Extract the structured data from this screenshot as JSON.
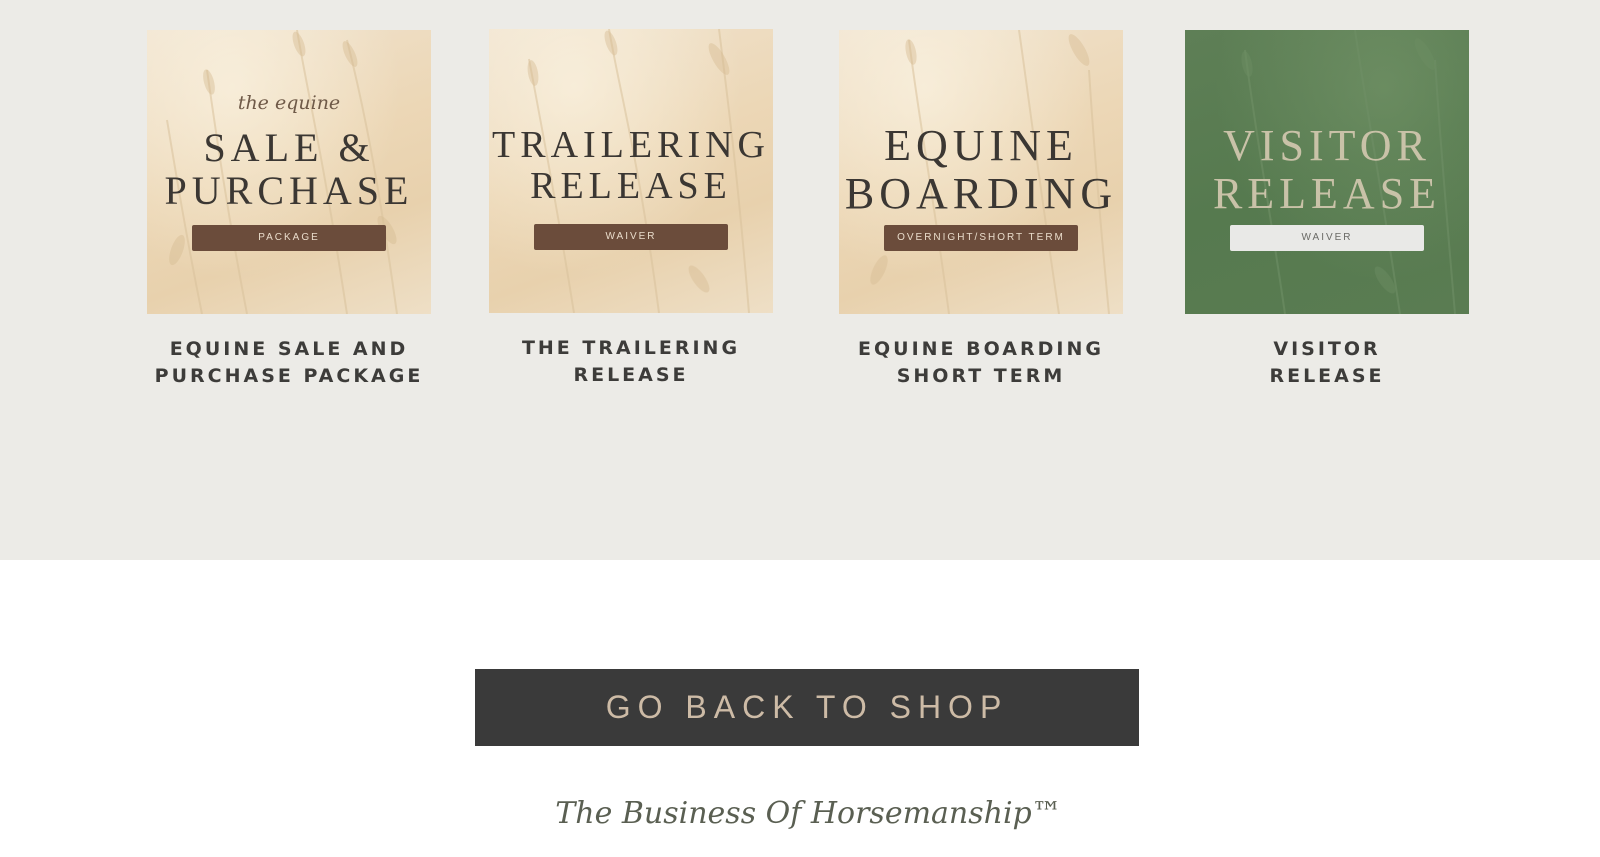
{
  "products": [
    {
      "script": "the equine",
      "title_lines": [
        "SALE &",
        "PURCHASE"
      ],
      "badge": "PACKAGE",
      "name_lines": [
        "EQUINE SALE AND",
        "PURCHASE PACKAGE"
      ],
      "theme": "wheat"
    },
    {
      "script": "",
      "title_lines": [
        "TRAILERING",
        "RELEASE"
      ],
      "badge": "WAIVER",
      "name_lines": [
        "THE TRAILERING",
        "RELEASE"
      ],
      "theme": "wheat"
    },
    {
      "script": "",
      "title_lines": [
        "EQUINE",
        "BOARDING"
      ],
      "badge": "OVERNIGHT/SHORT TERM",
      "name_lines": [
        "EQUINE BOARDING",
        "SHORT TERM"
      ],
      "theme": "wheat"
    },
    {
      "script": "",
      "title_lines": [
        "VISITOR",
        "RELEASE"
      ],
      "badge": "WAIVER",
      "name_lines": [
        "VISITOR",
        "RELEASE"
      ],
      "theme": "green"
    }
  ],
  "cta": {
    "label": "GO BACK TO SHOP"
  },
  "tagline": "The Business Of Horsemanship™",
  "colors": {
    "section_bg": "#ecebe7",
    "badge_brown": "#6b4c3b",
    "card_green": "#5a7c52",
    "button_bg": "#3a3a3a",
    "button_text": "#cdbba6"
  }
}
